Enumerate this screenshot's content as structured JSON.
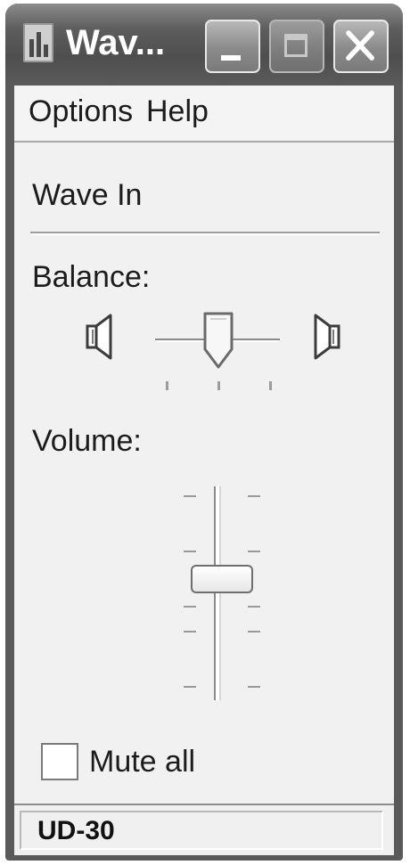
{
  "window": {
    "title": "Wav...",
    "buttons": {
      "minimize_icon": "minimize-icon",
      "maximize_icon": "maximize-icon",
      "close_icon": "close-icon"
    }
  },
  "menu": {
    "items": [
      {
        "label": "Options"
      },
      {
        "label": "Help"
      }
    ]
  },
  "control": {
    "device_name": "Wave In",
    "balance": {
      "label": "Balance:",
      "value": 0.5,
      "left_icon": "speaker-left-icon",
      "right_icon": "speaker-right-icon"
    },
    "volume": {
      "label": "Volume:",
      "value": 0.5
    },
    "mute": {
      "label": "Mute all",
      "checked": false
    }
  },
  "status": {
    "text": "UD-30"
  },
  "colors": {
    "titlebar": "#5a5a5a",
    "client": "#f1f1f1"
  }
}
